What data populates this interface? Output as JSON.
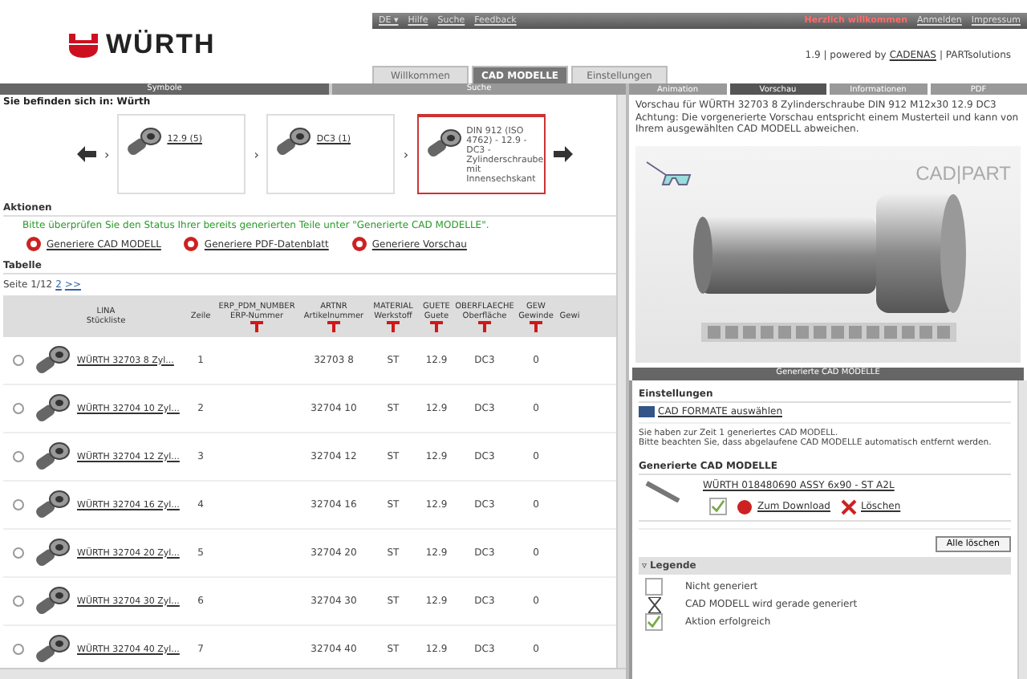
{
  "top_links": {
    "language": "DE ▾",
    "items": [
      "Hilfe",
      "Suche",
      "Feedback"
    ]
  },
  "account": {
    "greeting": "Herzlich willkommen",
    "links": [
      "Anmelden",
      "Impressum"
    ]
  },
  "logo": {
    "text": "WÜRTH"
  },
  "tabs": [
    {
      "label": "Willkommen",
      "selected": false
    },
    {
      "label": "CAD MODELLE",
      "selected": true
    },
    {
      "label": "Einstellungen",
      "selected": false
    }
  ],
  "version": {
    "text": "1.9 | powered by",
    "brand": "CADENAS",
    "product": "| PARTsolutions"
  },
  "crumb_separator": "›",
  "left_header": {
    "col_1": "Symbole",
    "col_2": "Suche"
  },
  "location": "Sie befinden sich in: Würth",
  "breadcrumb": [
    {
      "label": "12.9 (5)",
      "selected": false
    },
    {
      "label": "DC3 (1)",
      "selected": false
    },
    {
      "label": "DIN 912 (ISO 4762) - 12.9 - DC3 - Zylinderschraube mit Innensechskant",
      "selected": true
    }
  ],
  "actions": {
    "title": "Aktionen",
    "notice": "Bitte überprüfen Sie den Status Ihrer bereits generierten Teile unter \"Generierte CAD MODELLE\".",
    "links": [
      "Generiere CAD MODELL",
      "Generiere PDF-Datenblatt",
      "Generiere Vorschau"
    ]
  },
  "table": {
    "title": "Tabelle",
    "pager": {
      "label": "Seite 1/12",
      "links": [
        "2",
        ">>"
      ]
    },
    "columns": [
      {
        "code": "LINA",
        "label": "Stückliste",
        "filter": false
      },
      {
        "label": "Zeile",
        "filter": false
      },
      {
        "code": "ERP_PDM_NUMBER",
        "label": "ERP-Nummer",
        "filter": true
      },
      {
        "code": "ARTNR",
        "label": "Artikelnummer",
        "filter": true
      },
      {
        "code": "MATERIAL",
        "label": "Werkstoff",
        "filter": true
      },
      {
        "code": "GUETE",
        "label": "Guete",
        "filter": true
      },
      {
        "code": "OBERFLAECHE",
        "label": "Oberfläche",
        "filter": true
      },
      {
        "code": "GEW",
        "label": "Gewinde",
        "filter": true
      },
      {
        "label": "Gewi",
        "filter": false
      }
    ],
    "rows": [
      {
        "selected": false,
        "name": "WÜRTH 32703 8 Zyl...",
        "line": "1",
        "artnr": "32703 8",
        "material": "ST",
        "guete": "12.9",
        "surface": "DC3",
        "gew": "0"
      },
      {
        "selected": false,
        "name": "WÜRTH 32704 10 Zyl...",
        "line": "2",
        "artnr": "32704 10",
        "material": "ST",
        "guete": "12.9",
        "surface": "DC3",
        "gew": "0"
      },
      {
        "selected": false,
        "name": "WÜRTH 32704 12 Zyl...",
        "line": "3",
        "artnr": "32704 12",
        "material": "ST",
        "guete": "12.9",
        "surface": "DC3",
        "gew": "0"
      },
      {
        "selected": false,
        "name": "WÜRTH 32704 16 Zyl...",
        "line": "4",
        "artnr": "32704 16",
        "material": "ST",
        "guete": "12.9",
        "surface": "DC3",
        "gew": "0"
      },
      {
        "selected": false,
        "name": "WÜRTH 32704 20 Zyl...",
        "line": "5",
        "artnr": "32704 20",
        "material": "ST",
        "guete": "12.9",
        "surface": "DC3",
        "gew": "0"
      },
      {
        "selected": false,
        "name": "WÜRTH 32704 30 Zyl...",
        "line": "6",
        "artnr": "32704 30",
        "material": "ST",
        "guete": "12.9",
        "surface": "DC3",
        "gew": "0"
      },
      {
        "selected": false,
        "name": "WÜRTH 32704 40 Zyl...",
        "line": "7",
        "artnr": "32704 40",
        "material": "ST",
        "guete": "12.9",
        "surface": "DC3",
        "gew": "0"
      }
    ]
  },
  "right_tabs": [
    {
      "label": "Animation",
      "selected": false
    },
    {
      "label": "Vorschau",
      "selected": true
    },
    {
      "label": "Informationen",
      "selected": false
    },
    {
      "label": "PDF",
      "selected": false
    }
  ],
  "preview": {
    "caption": "Vorschau für WÜRTH 32703 8 Zylinderschraube DIN 912 M12x30 12.9 DC3",
    "warning": "Achtung: Die vorgenerierte Vorschau entspricht einem Musterteil und kann von Ihrem ausgewählten CAD MODELL abweichen.",
    "viewer_logo": "CAD|PART"
  },
  "generated": {
    "title": "Generierte CAD MODELLE",
    "settings_title": "Einstellungen",
    "formats_link": "CAD FORMATE auswählen",
    "info": [
      "Sie haben zur Zeit 1 generiertes CAD MODELL.",
      "Bitte beachten Sie, dass abgelaufene CAD MODELLE automatisch entfernt werden."
    ],
    "list_title": "Generierte CAD MODELLE",
    "items": [
      {
        "name": "WÜRTH 018480690 ASSY 6x90 - ST A2L",
        "done": true,
        "download": "Zum Download",
        "delete": "Löschen"
      }
    ],
    "delete_all": "Alle löschen",
    "legend": {
      "toggle": "▿",
      "title": "Legende",
      "items": [
        {
          "kind": "empty",
          "label": "Nicht generiert"
        },
        {
          "kind": "hourglass",
          "label": "CAD MODELL wird gerade generiert"
        },
        {
          "kind": "check",
          "label": "Aktion erfolgreich"
        }
      ]
    }
  }
}
